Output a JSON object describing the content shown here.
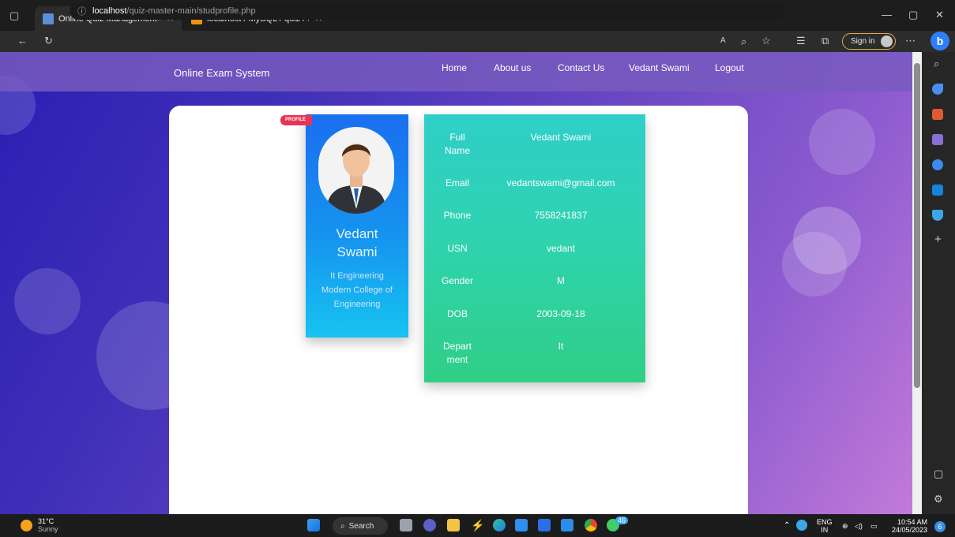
{
  "browser": {
    "tabs": [
      {
        "title": "Online Quiz Management Syster",
        "active": true
      },
      {
        "title": "localhost / MySQL / quiz / studer",
        "active": false
      }
    ],
    "url_host": "localhost",
    "url_path": "/quiz-master-main/studprofile.php",
    "signin_label": "Sign in"
  },
  "nav": {
    "brand": "Online Exam System",
    "links": [
      "Home",
      "About us",
      "Contact Us",
      "Vedant Swami",
      "Logout"
    ]
  },
  "profile": {
    "ribbon": "PROFILE",
    "name_line1": "Vedant",
    "name_line2": "Swami",
    "branch": "It Engineering",
    "college_line1": "Modern College of",
    "college_line2": "Engineering"
  },
  "details": [
    {
      "label1": "Full",
      "label2": "Name",
      "value": "Vedant Swami"
    },
    {
      "label1": "Email",
      "label2": "",
      "value": "vedantswami@gmail.com"
    },
    {
      "label1": "Phone",
      "label2": "",
      "value": "7558241837"
    },
    {
      "label1": "USN",
      "label2": "",
      "value": "vedant"
    },
    {
      "label1": "Gender",
      "label2": "",
      "value": "M"
    },
    {
      "label1": "DOB",
      "label2": "",
      "value": "2003-09-18"
    },
    {
      "label1": "Depart",
      "label2": "ment",
      "value": "It"
    }
  ],
  "taskbar": {
    "temp": "31°C",
    "condition": "Sunny",
    "search_label": "Search",
    "lang1": "ENG",
    "lang2": "IN",
    "time": "10:54 AM",
    "date": "24/05/2023",
    "notif_badge": "46",
    "tray_count": "6"
  },
  "colors": {
    "accent_profile": "#1a6ef0",
    "accent_details": "#2fd3b0",
    "ribbon": "#e83355"
  }
}
